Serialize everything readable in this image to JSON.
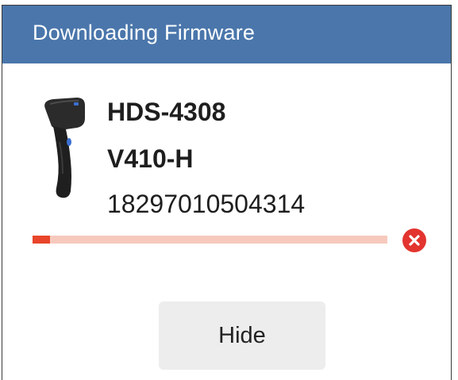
{
  "dialog": {
    "title": "Downloading Firmware",
    "title_bar_color": "#4a76ab"
  },
  "device": {
    "icon": "barcode-scanner-icon",
    "model": "HDS-4308",
    "version": "V410-H",
    "serial": "18297010504314"
  },
  "progress": {
    "value_percent": 5,
    "track_color": "#f7c9bd",
    "fill_color": "#e8452b"
  },
  "cancel": {
    "icon": "close-circle-icon",
    "color": "#e3342f"
  },
  "actions": {
    "hide_label": "Hide"
  }
}
